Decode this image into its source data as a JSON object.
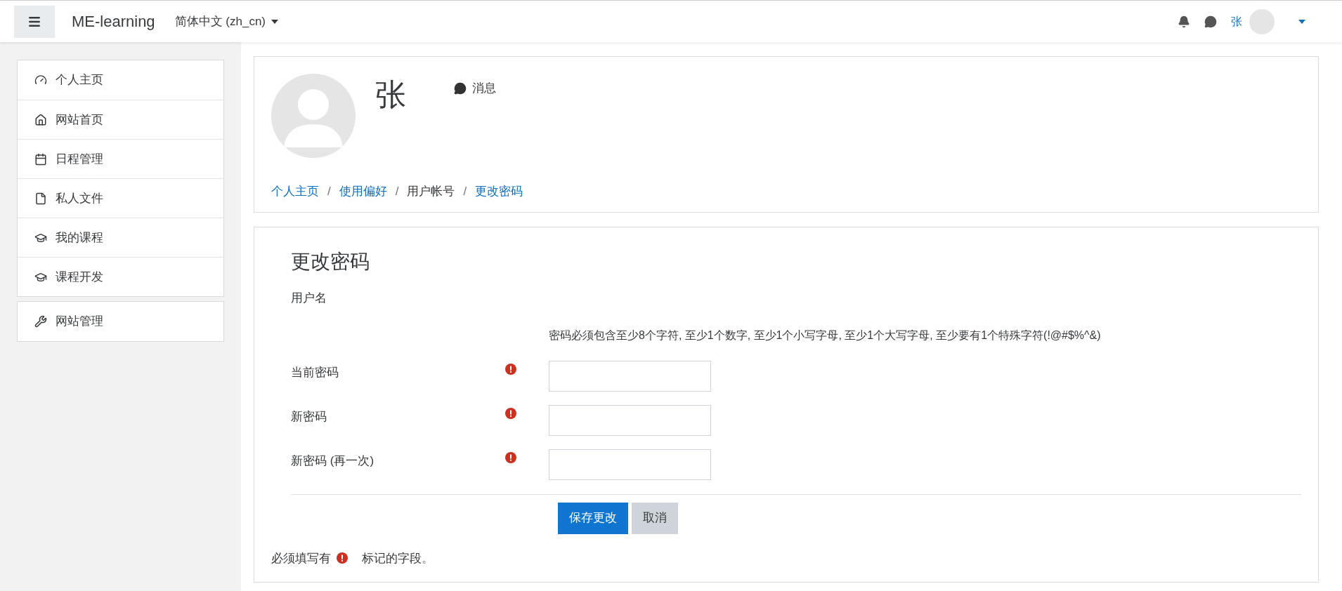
{
  "navbar": {
    "brand": "ME-learning",
    "language": "简体中文 (zh_cn)",
    "user_name": "张"
  },
  "sidebar": {
    "groups": [
      [
        {
          "label": "个人主页",
          "kind": "dashboard"
        },
        {
          "label": "网站首页",
          "kind": "home"
        },
        {
          "label": "日程管理",
          "kind": "calendar"
        },
        {
          "label": "私人文件",
          "kind": "file"
        },
        {
          "label": "我的课程",
          "kind": "course"
        },
        {
          "label": "课程开发",
          "kind": "course"
        }
      ],
      [
        {
          "label": "网站管理",
          "kind": "admin"
        }
      ]
    ]
  },
  "profile": {
    "name": "张",
    "message_link": "消息"
  },
  "breadcrumb": {
    "separator": "/",
    "items": [
      {
        "label": "个人主页",
        "link": true
      },
      {
        "label": "使用偏好",
        "link": true
      },
      {
        "label": "用户帐号",
        "link": false
      },
      {
        "label": "更改密码",
        "link": true
      }
    ]
  },
  "form": {
    "title": "更改密码",
    "username_label": "用户名",
    "policy": "密码必须包含至少8个字符, 至少1个数字, 至少1个小写字母, 至少1个大写字母, 至少要有1个特殊字符(!@#$%^&)",
    "fields": [
      {
        "label": "当前密码",
        "required": true
      },
      {
        "label": "新密码",
        "required": true
      },
      {
        "label": "新密码 (再一次)",
        "required": true
      }
    ],
    "buttons": [
      {
        "label": "保存更改",
        "kind": "primary"
      },
      {
        "label": "取消",
        "kind": "secondary"
      }
    ],
    "required_note": [
      "必须填写有",
      "标记的字段。"
    ]
  }
}
